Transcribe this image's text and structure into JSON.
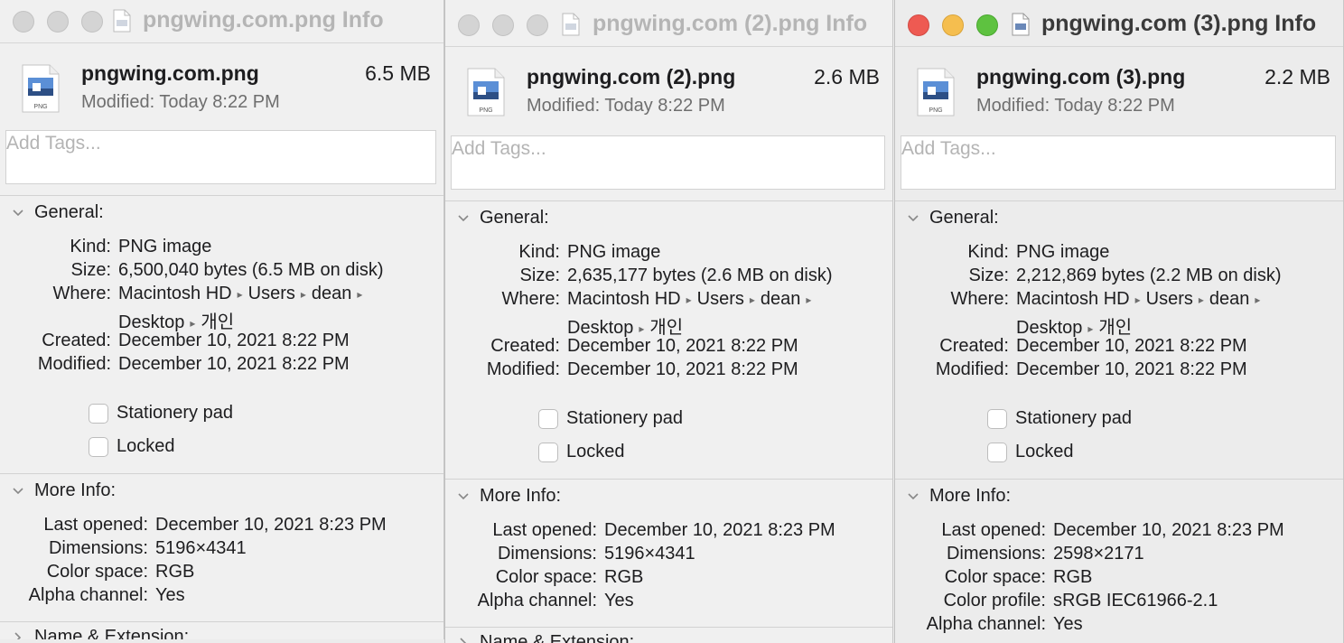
{
  "windows": [
    {
      "title": "pngwing.com.png Info",
      "file_name": "pngwing.com.png",
      "file_size": "6.5 MB",
      "modified_label": "Modified:",
      "modified_value": "Today 8:22 PM",
      "tags_placeholder": "Add Tags...",
      "icon_label": "PNG",
      "general": {
        "heading": "General:",
        "kind_label": "Kind:",
        "kind": "PNG image",
        "size_label": "Size:",
        "size": "6,500,040 bytes (6.5 MB on disk)",
        "where_label": "Where:",
        "where_parts": [
          "Macintosh HD",
          "Users",
          "dean"
        ],
        "where_line2": [
          "Desktop",
          "개인"
        ],
        "created_label": "Created:",
        "created": "December 10, 2021 8:22 PM",
        "modified_label": "Modified:",
        "modified": "December 10, 2021 8:22 PM",
        "stationery": "Stationery pad",
        "locked": "Locked"
      },
      "more_info": {
        "heading": "More Info:",
        "rows": [
          {
            "label": "Last opened:",
            "value": "December 10, 2021 8:23 PM"
          },
          {
            "label": "Dimensions:",
            "value": "5196×4341"
          },
          {
            "label": "Color space:",
            "value": "RGB"
          },
          {
            "label": "Alpha channel:",
            "value": "Yes"
          }
        ]
      },
      "name_ext": "Name & Extension:"
    },
    {
      "title": "pngwing.com (2).png Info",
      "file_name": "pngwing.com (2).png",
      "file_size": "2.6 MB",
      "modified_label": "Modified:",
      "modified_value": "Today 8:22 PM",
      "tags_placeholder": "Add Tags...",
      "icon_label": "PNG",
      "general": {
        "heading": "General:",
        "kind_label": "Kind:",
        "kind": "PNG image",
        "size_label": "Size:",
        "size": "2,635,177 bytes (2.6 MB on disk)",
        "where_label": "Where:",
        "where_parts": [
          "Macintosh HD",
          "Users",
          "dean"
        ],
        "where_line2": [
          "Desktop",
          "개인"
        ],
        "created_label": "Created:",
        "created": "December 10, 2021 8:22 PM",
        "modified_label": "Modified:",
        "modified": "December 10, 2021 8:22 PM",
        "stationery": "Stationery pad",
        "locked": "Locked"
      },
      "more_info": {
        "heading": "More Info:",
        "rows": [
          {
            "label": "Last opened:",
            "value": "December 10, 2021 8:23 PM"
          },
          {
            "label": "Dimensions:",
            "value": "5196×4341"
          },
          {
            "label": "Color space:",
            "value": "RGB"
          },
          {
            "label": "Alpha channel:",
            "value": "Yes"
          }
        ]
      },
      "name_ext": "Name & Extension:"
    },
    {
      "title": "pngwing.com (3).png Info",
      "file_name": "pngwing.com (3).png",
      "file_size": "2.2 MB",
      "modified_label": "Modified:",
      "modified_value": "Today 8:22 PM",
      "tags_placeholder": "Add Tags...",
      "icon_label": "PNG",
      "general": {
        "heading": "General:",
        "kind_label": "Kind:",
        "kind": "PNG image",
        "size_label": "Size:",
        "size": "2,212,869 bytes (2.2 MB on disk)",
        "where_label": "Where:",
        "where_parts": [
          "Macintosh HD",
          "Users",
          "dean"
        ],
        "where_line2": [
          "Desktop",
          "개인"
        ],
        "created_label": "Created:",
        "created": "December 10, 2021 8:22 PM",
        "modified_label": "Modified:",
        "modified": "December 10, 2021 8:22 PM",
        "stationery": "Stationery pad",
        "locked": "Locked"
      },
      "more_info": {
        "heading": "More Info:",
        "rows": [
          {
            "label": "Last opened:",
            "value": "December 10, 2021 8:23 PM"
          },
          {
            "label": "Dimensions:",
            "value": "2598×2171"
          },
          {
            "label": "Color space:",
            "value": "RGB"
          },
          {
            "label": "Color profile:",
            "value": "sRGB IEC61966-2.1"
          },
          {
            "label": "Alpha channel:",
            "value": "Yes"
          }
        ]
      },
      "name_ext": ""
    }
  ],
  "active_window": 2
}
